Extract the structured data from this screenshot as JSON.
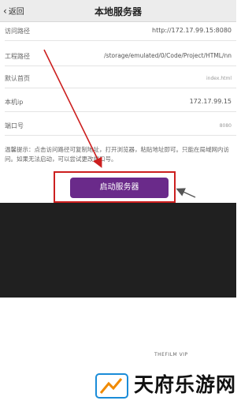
{
  "titlebar": {
    "back_label": "返回",
    "title": "本地服务器"
  },
  "settings": {
    "rows": [
      {
        "label": "访问路径",
        "value": "http://172.17.99.15:8080"
      },
      {
        "label": "工程路径",
        "value": "/storage/emulated/0/Code/Project/HTML/nn"
      },
      {
        "label": "默认首页",
        "value": "index.html"
      },
      {
        "label": "本机ip",
        "value": "172.17.99.15"
      },
      {
        "label": "端口号",
        "value": "8080"
      }
    ]
  },
  "tip": {
    "text": "温馨提示：点击访问路径可复制地址，打开浏览器，粘贴地址即可。只能在局域网内访问。如果无法启动，可以尝试更改端口号。"
  },
  "actions": {
    "start_server_label": "启动服务器"
  },
  "branding": {
    "watermark": "THEFILM VIP",
    "brand_name": "天府乐游网"
  },
  "colors": {
    "button": "#6a2a8a",
    "highlight": "#cc1f1f"
  }
}
